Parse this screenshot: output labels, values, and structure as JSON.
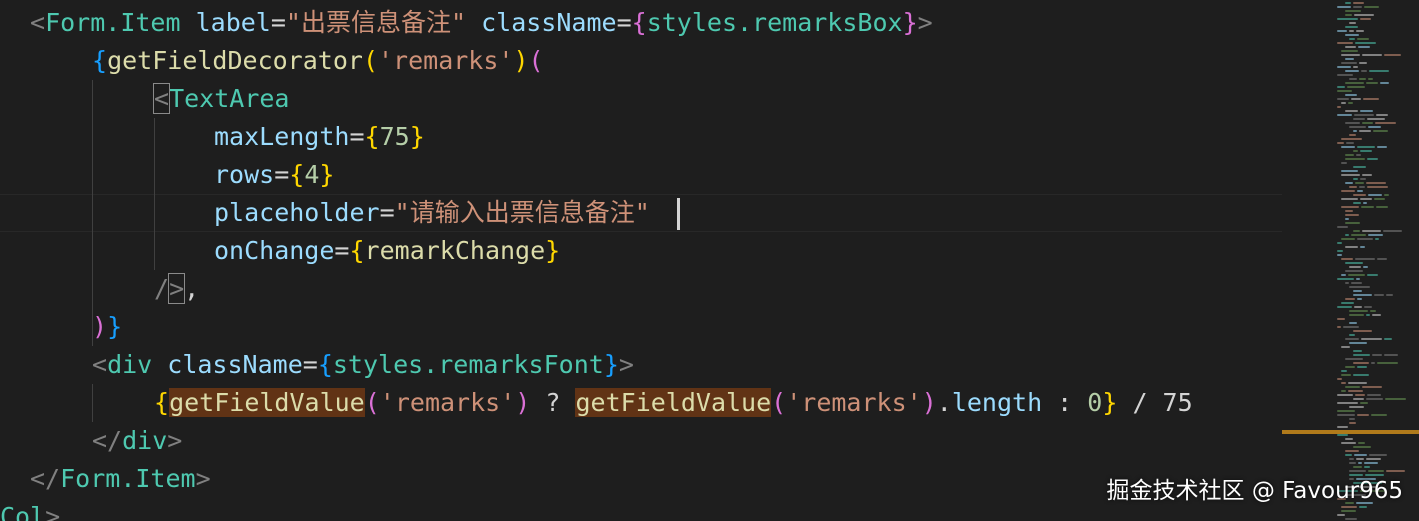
{
  "editor": {
    "background": "#1e1e1e",
    "lines": [
      {
        "tokens": [
          {
            "c": "punc",
            "t": "<"
          },
          {
            "c": "tag",
            "t": "Form.Item"
          },
          {
            "c": "op",
            "t": " "
          },
          {
            "c": "attr",
            "t": "label"
          },
          {
            "c": "eq",
            "t": "="
          },
          {
            "c": "str",
            "t": "\"出票信息备注\""
          },
          {
            "c": "op",
            "t": " "
          },
          {
            "c": "attr",
            "t": "className"
          },
          {
            "c": "eq",
            "t": "="
          },
          {
            "c": "br2",
            "t": "{"
          },
          {
            "c": "tag",
            "t": "styles.remarksBox"
          },
          {
            "c": "br2",
            "t": "}"
          },
          {
            "c": "punc",
            "t": ">"
          }
        ]
      },
      {
        "tokens": [
          {
            "c": "br3",
            "t": "{"
          },
          {
            "c": "fn",
            "t": "getFieldDecorator"
          },
          {
            "c": "br1",
            "t": "("
          },
          {
            "c": "str",
            "t": "'remarks'"
          },
          {
            "c": "br1",
            "t": ")"
          },
          {
            "c": "br2",
            "t": "("
          }
        ]
      },
      {
        "tokens": [
          {
            "c": "punc",
            "t": "<",
            "match": true
          },
          {
            "c": "tag",
            "t": "TextArea"
          }
        ]
      },
      {
        "tokens": [
          {
            "c": "attr",
            "t": "maxLength"
          },
          {
            "c": "eq",
            "t": "="
          },
          {
            "c": "br1",
            "t": "{"
          },
          {
            "c": "num",
            "t": "75"
          },
          {
            "c": "br1",
            "t": "}"
          }
        ]
      },
      {
        "tokens": [
          {
            "c": "attr",
            "t": "rows"
          },
          {
            "c": "eq",
            "t": "="
          },
          {
            "c": "br1",
            "t": "{"
          },
          {
            "c": "num",
            "t": "4"
          },
          {
            "c": "br1",
            "t": "}"
          }
        ]
      },
      {
        "tokens": [
          {
            "c": "attr",
            "t": "placeholder"
          },
          {
            "c": "eq",
            "t": "="
          },
          {
            "c": "str",
            "t": "\"请输入出票信息备注\""
          }
        ]
      },
      {
        "tokens": [
          {
            "c": "attr",
            "t": "onChange"
          },
          {
            "c": "eq",
            "t": "="
          },
          {
            "c": "br1",
            "t": "{"
          },
          {
            "c": "fn",
            "t": "remarkChange"
          },
          {
            "c": "br1",
            "t": "}"
          }
        ]
      },
      {
        "tokens": [
          {
            "c": "punc",
            "t": "/"
          },
          {
            "c": "punc",
            "t": ">",
            "match": true
          },
          {
            "c": "op",
            "t": ","
          }
        ]
      },
      {
        "tokens": [
          {
            "c": "br2",
            "t": ")"
          },
          {
            "c": "br3",
            "t": "}"
          }
        ]
      },
      {
        "tokens": [
          {
            "c": "punc",
            "t": "<"
          },
          {
            "c": "tag",
            "t": "div"
          },
          {
            "c": "op",
            "t": " "
          },
          {
            "c": "attr",
            "t": "className"
          },
          {
            "c": "eq",
            "t": "="
          },
          {
            "c": "br3",
            "t": "{"
          },
          {
            "c": "tag",
            "t": "styles.remarksFont"
          },
          {
            "c": "br3",
            "t": "}"
          },
          {
            "c": "punc",
            "t": ">"
          }
        ]
      },
      {
        "tokens": [
          {
            "c": "br1",
            "t": "{"
          },
          {
            "c": "fn",
            "t": "getFieldValue",
            "hl": true
          },
          {
            "c": "br2",
            "t": "("
          },
          {
            "c": "str",
            "t": "'remarks'"
          },
          {
            "c": "br2",
            "t": ")"
          },
          {
            "c": "op",
            "t": " ? "
          },
          {
            "c": "fn",
            "t": "getFieldValue",
            "hl": true
          },
          {
            "c": "br2",
            "t": "("
          },
          {
            "c": "str",
            "t": "'remarks'"
          },
          {
            "c": "br2",
            "t": ")"
          },
          {
            "c": "op",
            "t": "."
          },
          {
            "c": "var",
            "t": "length"
          },
          {
            "c": "op",
            "t": " : "
          },
          {
            "c": "num",
            "t": "0"
          },
          {
            "c": "br1",
            "t": "}"
          },
          {
            "c": "op",
            "t": " / 75"
          }
        ]
      },
      {
        "tokens": [
          {
            "c": "punc",
            "t": "</"
          },
          {
            "c": "tag",
            "t": "div"
          },
          {
            "c": "punc",
            "t": ">"
          }
        ]
      },
      {
        "tokens": [
          {
            "c": "punc",
            "t": "</"
          },
          {
            "c": "tag",
            "t": "Form.Item"
          },
          {
            "c": "punc",
            "t": ">"
          }
        ]
      },
      {
        "tokens": [
          {
            "c": "tag",
            "t": "Col"
          },
          {
            "c": "punc",
            "t": ">"
          }
        ]
      }
    ]
  },
  "minimap": {
    "colors": [
      "#6a9955",
      "#4ec9b0",
      "#9cdcfe",
      "#ce9178",
      "#808080",
      "#d4d4d4"
    ]
  },
  "watermark": {
    "text": "掘金技术社区 @ Favour965"
  }
}
